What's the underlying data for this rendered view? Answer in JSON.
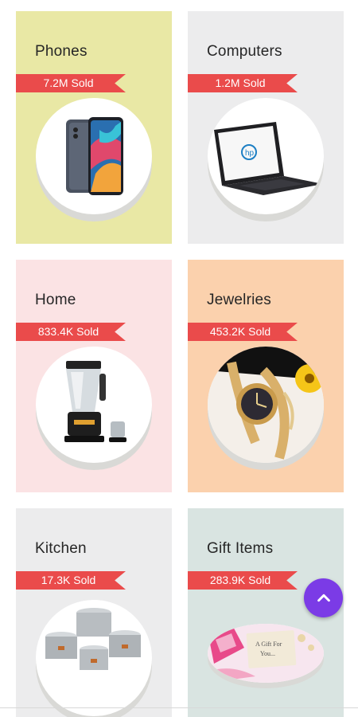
{
  "categories": [
    {
      "title": "Phones",
      "sold": "7.2M Sold",
      "image_icon": "phone-image"
    },
    {
      "title": "Computers",
      "sold": "1.2M Sold",
      "image_icon": "laptop-image"
    },
    {
      "title": "Home",
      "sold": "833.4K Sold",
      "image_icon": "blender-image"
    },
    {
      "title": "Jewelries",
      "sold": "453.2K Sold",
      "image_icon": "watch-image"
    },
    {
      "title": "Kitchen",
      "sold": "17.3K Sold",
      "image_icon": "pots-image"
    },
    {
      "title": "Gift Items",
      "sold": "283.9K Sold",
      "image_icon": "gift-image"
    }
  ],
  "colors": {
    "ribbon": "#ea4b4b",
    "fab": "#7b3be6",
    "phones_bg": "#e9e8a5",
    "computers_bg": "#ececed",
    "home_bg": "#fbe3e4",
    "jewelries_bg": "#fbd1ad",
    "kitchen_bg": "#ececed",
    "gift_bg": "#d9e4e1"
  },
  "fab": {
    "icon": "chevron-up-icon"
  }
}
